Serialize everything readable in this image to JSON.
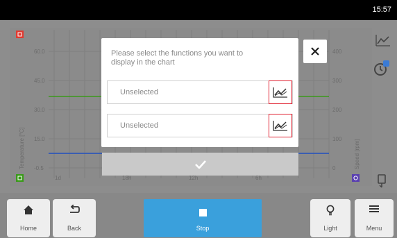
{
  "status_bar": {
    "time": "15:57"
  },
  "chart": {
    "left_ticks": [
      "60.0",
      "45.0",
      "30.0",
      "15.0",
      "-0.5"
    ],
    "right_ticks": [
      "400",
      "300",
      "200",
      "100",
      "0"
    ],
    "x_ticks": [
      "1d",
      "18h",
      "12h",
      "6h"
    ],
    "left_axis_label": "Temperature [°C]",
    "right_axis_label": "Speed [rpm]",
    "temperature_color": "#3a9a1a",
    "speed_color": "#2050c0"
  },
  "dialog": {
    "prompt": "Please select the functions you want to display in the chart",
    "select_1": {
      "value": "Unselected",
      "icon": "line-chart-icon"
    },
    "select_2": {
      "value": "Unselected",
      "icon": "line-chart-icon"
    },
    "close_icon": "close-icon",
    "confirm_icon": "check-icon"
  },
  "side_icons": [
    "chart-icon",
    "timer-icon",
    "probe-icon"
  ],
  "bottom_nav": {
    "home_label": "Home",
    "back_label": "Back",
    "stop_label": "Stop",
    "light_label": "Light",
    "menu_label": "Menu"
  }
}
